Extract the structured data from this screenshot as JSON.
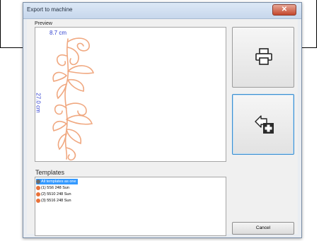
{
  "dialog": {
    "title": "Export to machine",
    "close_symbol": "✕"
  },
  "preview": {
    "label": "Preview",
    "width_label": "8.7 cm",
    "height_label": "27.0 cm"
  },
  "templates": {
    "label": "Templates",
    "items": [
      {
        "label": "All templates as one",
        "selected": true
      },
      {
        "label": "(1) 5S6 248 Sun",
        "selected": false
      },
      {
        "label": "(2) 5510 248 Sun",
        "selected": false
      },
      {
        "label": "(3) 5516 248 Sun",
        "selected": false
      }
    ]
  },
  "buttons": {
    "print_icon": "printer-icon",
    "export_icon": "export-to-machine-icon",
    "cancel_label": "Cancel"
  },
  "colors": {
    "design_stroke": "#f0a880",
    "dimension_text": "#2f3fcf",
    "selection": "#3399ff",
    "bullet": "#e8723a"
  }
}
